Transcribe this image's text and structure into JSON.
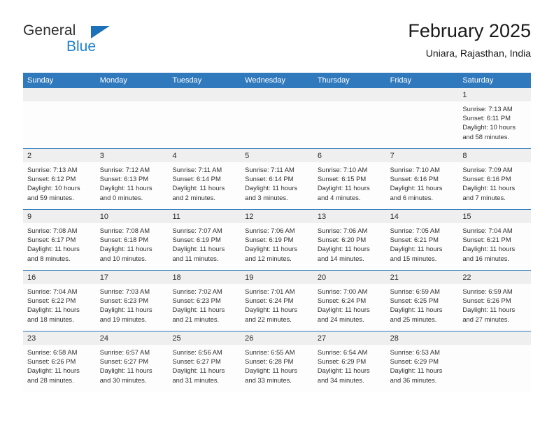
{
  "brand": {
    "name_top": "General",
    "name_bottom": "Blue",
    "triangle_color": "#1d71b8",
    "blue_text_color": "#1d82d0"
  },
  "header": {
    "title": "February 2025",
    "subtitle": "Uniara, Rajasthan, India"
  },
  "theme": {
    "header_blue": "#3079bd",
    "day_band_gray": "#efefef",
    "cell_background": "#fdfdfd"
  },
  "weekdays": [
    "Sunday",
    "Monday",
    "Tuesday",
    "Wednesday",
    "Thursday",
    "Friday",
    "Saturday"
  ],
  "weeks": [
    [
      {
        "day": "",
        "lines": []
      },
      {
        "day": "",
        "lines": []
      },
      {
        "day": "",
        "lines": []
      },
      {
        "day": "",
        "lines": []
      },
      {
        "day": "",
        "lines": []
      },
      {
        "day": "",
        "lines": []
      },
      {
        "day": "1",
        "lines": [
          "Sunrise: 7:13 AM",
          "Sunset: 6:11 PM",
          "Daylight: 10 hours",
          "and 58 minutes."
        ]
      }
    ],
    [
      {
        "day": "2",
        "lines": [
          "Sunrise: 7:13 AM",
          "Sunset: 6:12 PM",
          "Daylight: 10 hours",
          "and 59 minutes."
        ]
      },
      {
        "day": "3",
        "lines": [
          "Sunrise: 7:12 AM",
          "Sunset: 6:13 PM",
          "Daylight: 11 hours",
          "and 0 minutes."
        ]
      },
      {
        "day": "4",
        "lines": [
          "Sunrise: 7:11 AM",
          "Sunset: 6:14 PM",
          "Daylight: 11 hours",
          "and 2 minutes."
        ]
      },
      {
        "day": "5",
        "lines": [
          "Sunrise: 7:11 AM",
          "Sunset: 6:14 PM",
          "Daylight: 11 hours",
          "and 3 minutes."
        ]
      },
      {
        "day": "6",
        "lines": [
          "Sunrise: 7:10 AM",
          "Sunset: 6:15 PM",
          "Daylight: 11 hours",
          "and 4 minutes."
        ]
      },
      {
        "day": "7",
        "lines": [
          "Sunrise: 7:10 AM",
          "Sunset: 6:16 PM",
          "Daylight: 11 hours",
          "and 6 minutes."
        ]
      },
      {
        "day": "8",
        "lines": [
          "Sunrise: 7:09 AM",
          "Sunset: 6:16 PM",
          "Daylight: 11 hours",
          "and 7 minutes."
        ]
      }
    ],
    [
      {
        "day": "9",
        "lines": [
          "Sunrise: 7:08 AM",
          "Sunset: 6:17 PM",
          "Daylight: 11 hours",
          "and 8 minutes."
        ]
      },
      {
        "day": "10",
        "lines": [
          "Sunrise: 7:08 AM",
          "Sunset: 6:18 PM",
          "Daylight: 11 hours",
          "and 10 minutes."
        ]
      },
      {
        "day": "11",
        "lines": [
          "Sunrise: 7:07 AM",
          "Sunset: 6:19 PM",
          "Daylight: 11 hours",
          "and 11 minutes."
        ]
      },
      {
        "day": "12",
        "lines": [
          "Sunrise: 7:06 AM",
          "Sunset: 6:19 PM",
          "Daylight: 11 hours",
          "and 12 minutes."
        ]
      },
      {
        "day": "13",
        "lines": [
          "Sunrise: 7:06 AM",
          "Sunset: 6:20 PM",
          "Daylight: 11 hours",
          "and 14 minutes."
        ]
      },
      {
        "day": "14",
        "lines": [
          "Sunrise: 7:05 AM",
          "Sunset: 6:21 PM",
          "Daylight: 11 hours",
          "and 15 minutes."
        ]
      },
      {
        "day": "15",
        "lines": [
          "Sunrise: 7:04 AM",
          "Sunset: 6:21 PM",
          "Daylight: 11 hours",
          "and 16 minutes."
        ]
      }
    ],
    [
      {
        "day": "16",
        "lines": [
          "Sunrise: 7:04 AM",
          "Sunset: 6:22 PM",
          "Daylight: 11 hours",
          "and 18 minutes."
        ]
      },
      {
        "day": "17",
        "lines": [
          "Sunrise: 7:03 AM",
          "Sunset: 6:23 PM",
          "Daylight: 11 hours",
          "and 19 minutes."
        ]
      },
      {
        "day": "18",
        "lines": [
          "Sunrise: 7:02 AM",
          "Sunset: 6:23 PM",
          "Daylight: 11 hours",
          "and 21 minutes."
        ]
      },
      {
        "day": "19",
        "lines": [
          "Sunrise: 7:01 AM",
          "Sunset: 6:24 PM",
          "Daylight: 11 hours",
          "and 22 minutes."
        ]
      },
      {
        "day": "20",
        "lines": [
          "Sunrise: 7:00 AM",
          "Sunset: 6:24 PM",
          "Daylight: 11 hours",
          "and 24 minutes."
        ]
      },
      {
        "day": "21",
        "lines": [
          "Sunrise: 6:59 AM",
          "Sunset: 6:25 PM",
          "Daylight: 11 hours",
          "and 25 minutes."
        ]
      },
      {
        "day": "22",
        "lines": [
          "Sunrise: 6:59 AM",
          "Sunset: 6:26 PM",
          "Daylight: 11 hours",
          "and 27 minutes."
        ]
      }
    ],
    [
      {
        "day": "23",
        "lines": [
          "Sunrise: 6:58 AM",
          "Sunset: 6:26 PM",
          "Daylight: 11 hours",
          "and 28 minutes."
        ]
      },
      {
        "day": "24",
        "lines": [
          "Sunrise: 6:57 AM",
          "Sunset: 6:27 PM",
          "Daylight: 11 hours",
          "and 30 minutes."
        ]
      },
      {
        "day": "25",
        "lines": [
          "Sunrise: 6:56 AM",
          "Sunset: 6:27 PM",
          "Daylight: 11 hours",
          "and 31 minutes."
        ]
      },
      {
        "day": "26",
        "lines": [
          "Sunrise: 6:55 AM",
          "Sunset: 6:28 PM",
          "Daylight: 11 hours",
          "and 33 minutes."
        ]
      },
      {
        "day": "27",
        "lines": [
          "Sunrise: 6:54 AM",
          "Sunset: 6:29 PM",
          "Daylight: 11 hours",
          "and 34 minutes."
        ]
      },
      {
        "day": "28",
        "lines": [
          "Sunrise: 6:53 AM",
          "Sunset: 6:29 PM",
          "Daylight: 11 hours",
          "and 36 minutes."
        ]
      },
      {
        "day": "",
        "lines": []
      }
    ]
  ]
}
